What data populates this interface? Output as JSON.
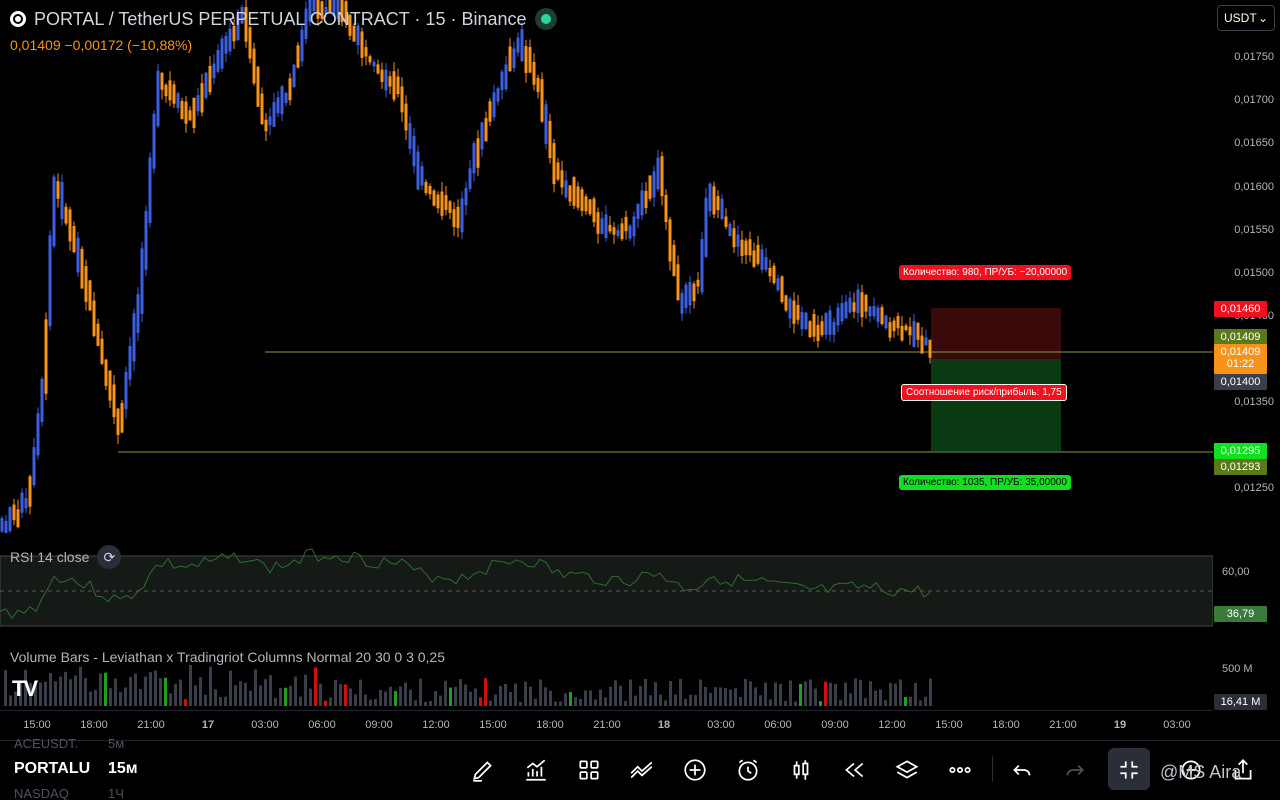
{
  "header": {
    "title": "PORTAL / TetherUS PERPETUAL CONTRACT · 15 · Binance",
    "ohlc": "0,01409  −0,00172 (−10,88%)",
    "currency": "USDT"
  },
  "price_scale": {
    "ticks": [
      "0,01750",
      "0,01700",
      "0,01650",
      "0,01600",
      "0,01550",
      "0,01500",
      "0,01450",
      "0,01350",
      "0,01250"
    ],
    "tags": {
      "stop": "0,01460",
      "high": "0,01409",
      "last": "0,01409",
      "countdown": "01:22",
      "entry": "0,01400",
      "target": "0,01295",
      "low": "0,01293"
    }
  },
  "position": {
    "stop_label": "Количество: 980, ПР/УБ: −20,00000",
    "ratio_label": "Соотношение риск/прибыль: 1,75",
    "target_label": "Количество: 1035, ПР/УБ: 35,00000"
  },
  "rsi": {
    "label": "RSI 14 close",
    "tick": "60,00",
    "value": "36,79"
  },
  "volume": {
    "label": "Volume Bars - Leviathan x Tradingriot Columns Normal 20 30 0 3 0,25",
    "tick": "500 M",
    "value": "16,41 M"
  },
  "time_axis": [
    "15:00",
    "18:00",
    "21:00",
    "17",
    "03:00",
    "06:00",
    "09:00",
    "12:00",
    "15:00",
    "18:00",
    "21:00",
    "18",
    "03:00",
    "06:00",
    "09:00",
    "12:00",
    "15:00",
    "18:00",
    "21:00",
    "19",
    "03:00"
  ],
  "watchlist": {
    "symbol": "PORTALU",
    "timeframe": "15м",
    "ghost_above_symbol": "ACEUSDT.",
    "ghost_above_tf": "5м",
    "ghost_below_symbol": "NASDAQ",
    "ghost_below_tf": "1Ч"
  },
  "watermark": "@MS Aira",
  "colors": {
    "up": "#3c5ee0",
    "down": "#f7931a",
    "stop_zone": "#3a0a0a",
    "target_zone": "#0a3a12",
    "red_label": "#f0101e",
    "green_label": "#10e020",
    "last_price": "#f7931a"
  }
}
